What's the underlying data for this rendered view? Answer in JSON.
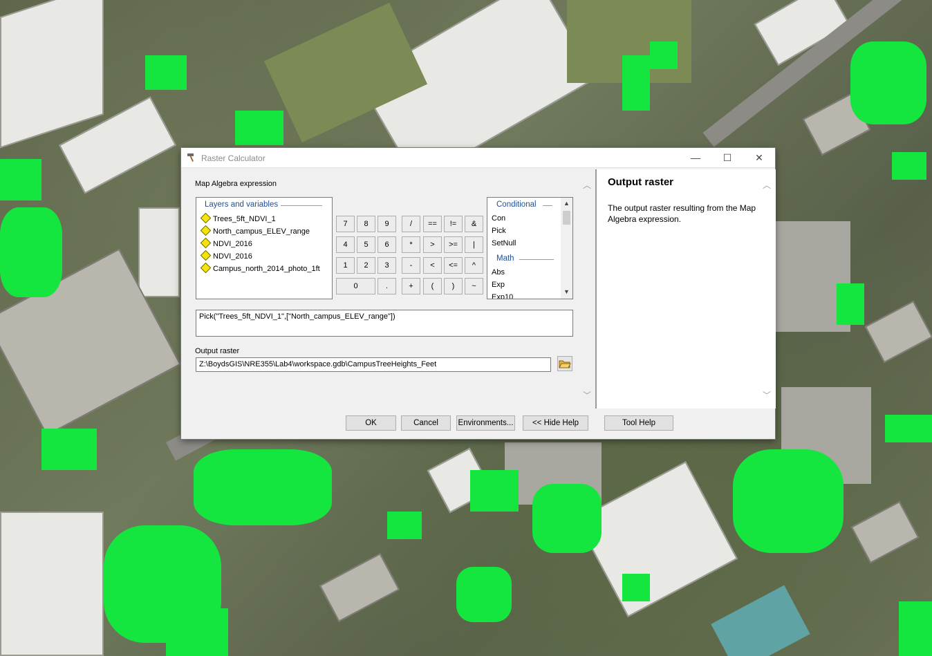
{
  "window": {
    "title": "Raster Calculator",
    "controls": {
      "minimize": "—",
      "maximize": "☐",
      "close": "✕"
    }
  },
  "left": {
    "expression_label": "Map Algebra expression",
    "layers_header": "Layers and variables",
    "layers": [
      "Trees_5ft_NDVI_1",
      "North_campus_ELEV_range",
      "NDVI_2016",
      "NDVI_2016",
      "Campus_north_2014_photo_1ft"
    ],
    "keypad": {
      "row1": [
        "7",
        "8",
        "9",
        "/",
        "==",
        "!=",
        "&"
      ],
      "row2": [
        "4",
        "5",
        "6",
        "*",
        ">",
        ">=",
        "|"
      ],
      "row3": [
        "1",
        "2",
        "3",
        "-",
        "<",
        "<=",
        "^"
      ],
      "row4": [
        "0",
        ".",
        "+",
        "(",
        ")",
        "~"
      ]
    },
    "functions": {
      "group1": "Conditional",
      "group1_items": [
        "Con",
        "Pick",
        "SetNull"
      ],
      "group2": "Math",
      "group2_items": [
        "Abs",
        "Exp",
        "Exp10"
      ]
    },
    "expression": "Pick(\"Trees_5ft_NDVI_1\",[\"North_campus_ELEV_range\"])",
    "output_label": "Output raster",
    "output_value": "Z:\\BoydsGIS\\NRE355\\Lab4\\workspace.gdb\\CampusTreeHeights_Feet"
  },
  "help": {
    "title": "Output raster",
    "body": "The output raster resulting from the Map Algebra expression."
  },
  "buttons": {
    "ok": "OK",
    "cancel": "Cancel",
    "environments": "Environments...",
    "hide_help": "<< Hide Help",
    "tool_help": "Tool Help"
  },
  "colors": {
    "tree_overlay": "#14e63f",
    "section_header": "#1c4fa0",
    "layer_icon": "#f6e20e"
  },
  "icons": {
    "title": "hammer-icon",
    "layer": "raster-layer-icon",
    "browse": "folder-open-icon"
  }
}
